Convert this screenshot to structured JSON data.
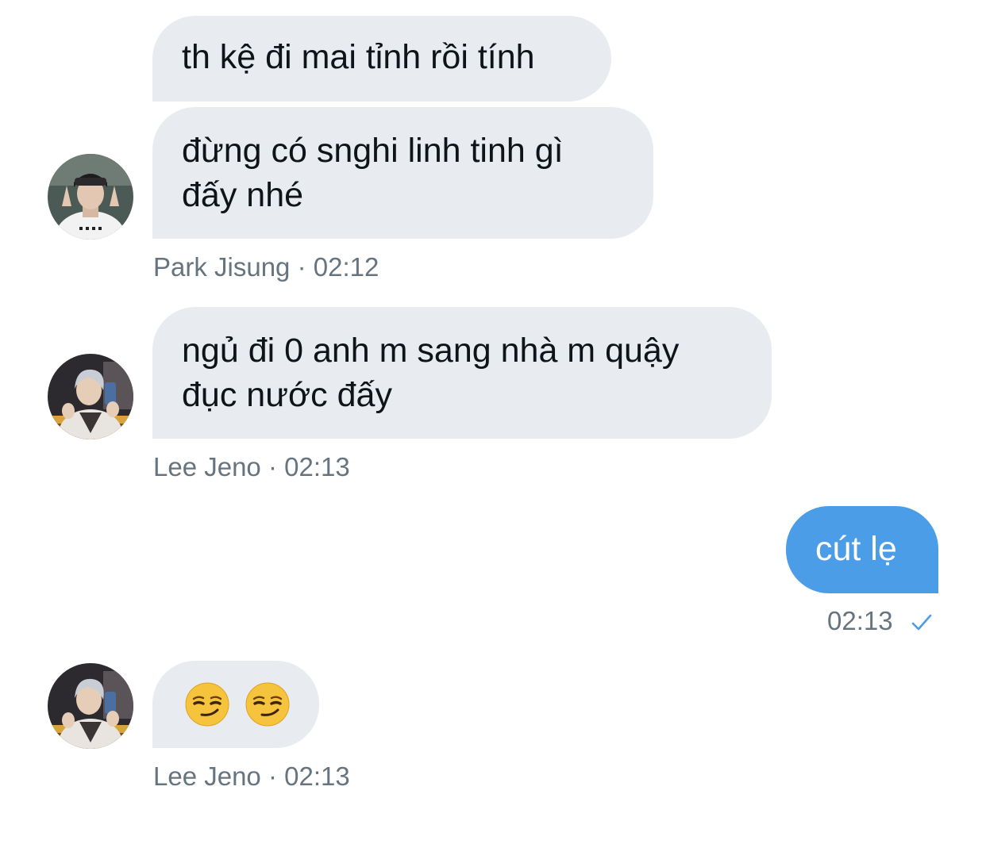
{
  "messages": [
    {
      "sender": "Park Jisung",
      "text": "th kệ đi mai tỉnh rồi tính"
    },
    {
      "sender": "Park Jisung",
      "text": "đừng có snghi linh tinh gì\nđấy nhé"
    },
    {
      "sender": "Lee Jeno",
      "text": "ngủ đi 0 anh m sang nhà m quậy\nđục nước đấy"
    },
    {
      "sender": "me",
      "text": "cút lẹ"
    },
    {
      "sender": "Lee Jeno",
      "emojis": [
        "smirking-face",
        "smirking-face"
      ]
    }
  ],
  "meta": {
    "jisung": {
      "name": "Park Jisung",
      "sep": "·",
      "time": "02:12"
    },
    "jeno1": {
      "name": "Lee Jeno",
      "sep": "·",
      "time": "02:13"
    },
    "mine": {
      "time": "02:13",
      "status_icon": "check-icon"
    },
    "jeno2": {
      "name": "Lee Jeno",
      "sep": "·",
      "time": "02:13"
    }
  },
  "colors": {
    "incoming_bubble": "#e8ebf0",
    "outgoing_bubble": "#4c9de8",
    "meta_text": "#66747f",
    "check": "#4c9de8"
  }
}
